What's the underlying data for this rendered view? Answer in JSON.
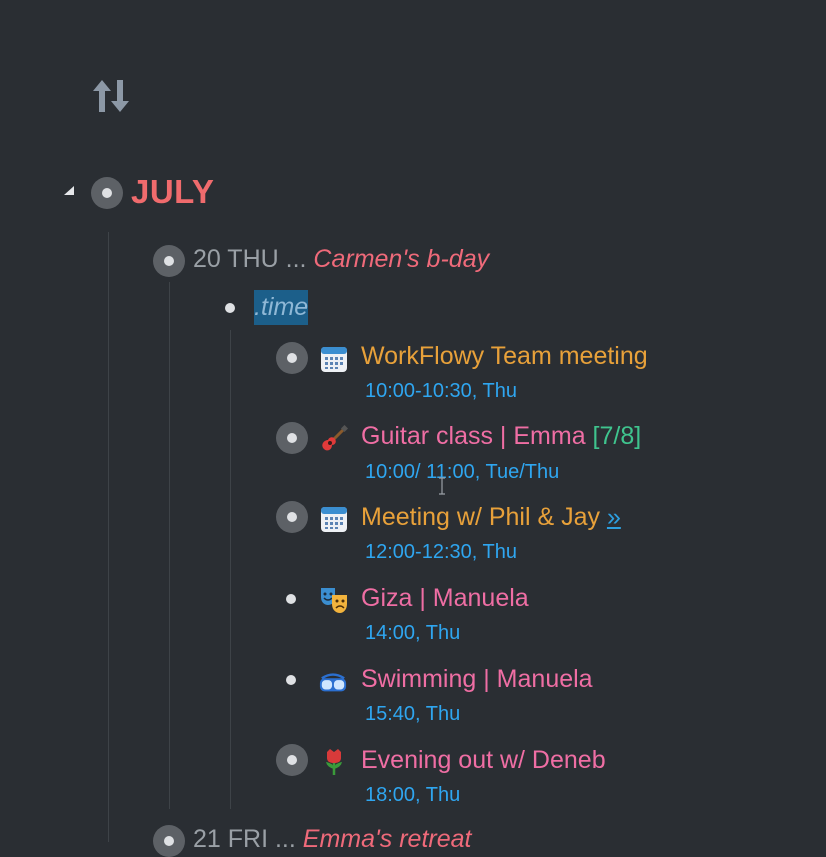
{
  "toolbar": {
    "sort_icon": "sort-arrows-icon"
  },
  "month": {
    "title": "JULY"
  },
  "day20": {
    "label": "20 THU ... ",
    "note": "Carmen's b-day"
  },
  "time_tag": ".time",
  "items": [
    {
      "icon": "calendar-icon",
      "title": "WorkFlowy Team meeting",
      "time": "10:00-10:30, Thu"
    },
    {
      "icon": "guitar-icon",
      "title": "Guitar class | Emma ",
      "progress": "[7/8]",
      "time": "10:00/ 11:00, Tue/Thu"
    },
    {
      "icon": "calendar-icon",
      "title": "Meeting w/ Phil & Jay ",
      "link": "»",
      "time": "12:00-12:30, Thu"
    },
    {
      "icon": "theater-masks-icon",
      "title": "Giza | Manuela",
      "time": "14:00, Thu"
    },
    {
      "icon": "goggles-icon",
      "title": "Swimming | Manuela",
      "time": "15:40, Thu"
    },
    {
      "icon": "rose-icon",
      "title": "Evening out w/ Deneb",
      "time": "18:00, Thu"
    }
  ],
  "day21": {
    "label": "21 FRI ... ",
    "note": "Emma's retreat"
  },
  "colors": {
    "background": "#2a2e33",
    "accent_red": "#f06b6d",
    "orange": "#e8a13a",
    "pink": "#ef6ea4",
    "blue": "#2fa6f0",
    "green": "#3fc48e"
  }
}
